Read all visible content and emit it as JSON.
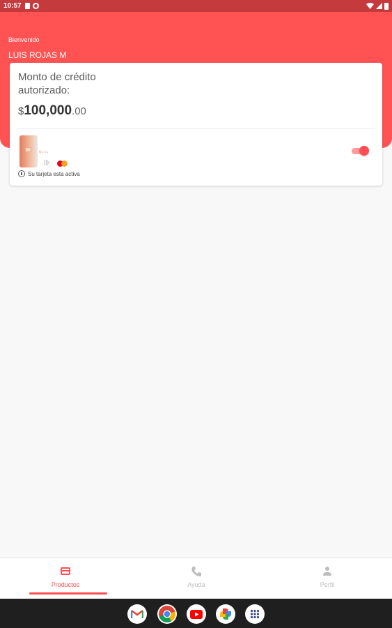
{
  "status_bar": {
    "time": "10:57"
  },
  "header": {
    "welcome": "Bienvenido",
    "user_name": "LUIS ROJAS M"
  },
  "credit": {
    "title": "Monto de crédito autorizado:",
    "currency": "$",
    "amount_integer": "100,000",
    "amount_decimal": ".00"
  },
  "card": {
    "status_text": "Su tarjeta esta activa",
    "active": true,
    "network": "mastercard-logo"
  },
  "nav": {
    "items": [
      {
        "label": "Productos",
        "icon": "credit-card-icon",
        "selected": true
      },
      {
        "label": "Ayuda",
        "icon": "phone-icon",
        "selected": false
      },
      {
        "label": "Perfil",
        "icon": "person-icon",
        "selected": false
      }
    ]
  },
  "colors": {
    "primary": "#ff5253",
    "status_bar": "#c43a3d",
    "inactive": "#bdbdbd"
  },
  "system_apps": [
    "gmail-icon",
    "chrome-icon",
    "youtube-icon",
    "photos-icon",
    "app-drawer-icon"
  ]
}
